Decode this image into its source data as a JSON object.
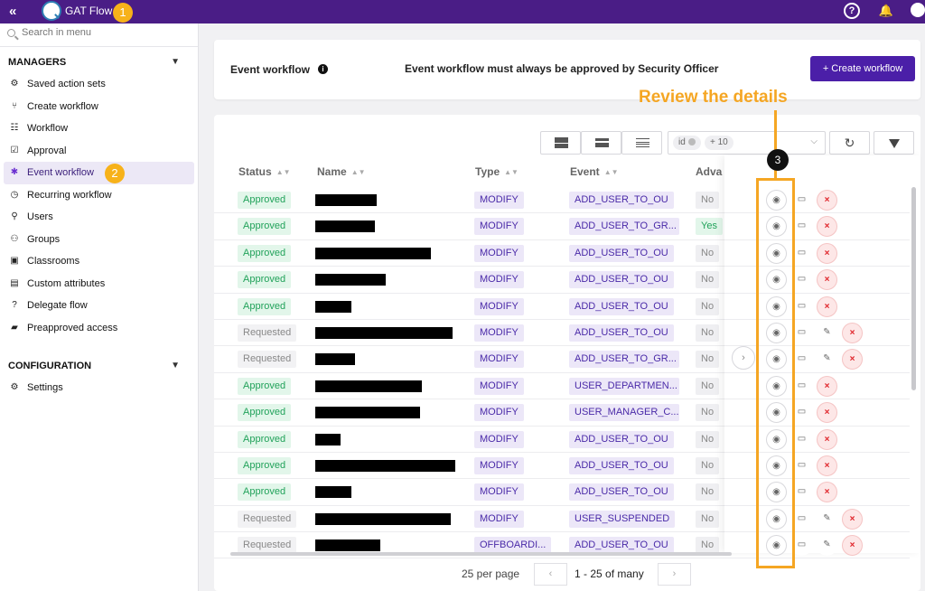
{
  "app": {
    "title": "GAT Flow"
  },
  "annotations": {
    "step1": "1",
    "step2": "2",
    "step3": "3",
    "callout": "Review the details"
  },
  "sidebar": {
    "search_placeholder": "Search in menu",
    "managers_label": "MANAGERS",
    "items": [
      {
        "label": "Saved action sets",
        "icon": "gears-icon"
      },
      {
        "label": "Create workflow",
        "icon": "fork-icon"
      },
      {
        "label": "Workflow",
        "icon": "hierarchy-icon"
      },
      {
        "label": "Approval",
        "icon": "checklist-icon"
      },
      {
        "label": "Event workflow",
        "icon": "siren-icon",
        "active": true
      },
      {
        "label": "Recurring workflow",
        "icon": "clock-icon"
      },
      {
        "label": "Users",
        "icon": "user-search-icon"
      },
      {
        "label": "Groups",
        "icon": "group-icon"
      },
      {
        "label": "Classrooms",
        "icon": "classroom-icon"
      },
      {
        "label": "Custom attributes",
        "icon": "id-card-icon"
      },
      {
        "label": "Delegate flow",
        "icon": "user-question-icon"
      },
      {
        "label": "Preapproved access",
        "icon": "ticket-icon"
      }
    ],
    "configuration_label": "CONFIGURATION",
    "settings_label": "Settings"
  },
  "header": {
    "title": "Event workflow",
    "message": "Event workflow must always be approved by Security Officer",
    "create_button": "+ Create workflow"
  },
  "toolbar": {
    "filter_chip_1": "id",
    "filter_chip_2": "+ 10"
  },
  "table": {
    "columns": {
      "status": "Status",
      "name": "Name",
      "type": "Type",
      "event": "Event",
      "advanced": "Adva"
    },
    "rows": [
      {
        "status": "Approved",
        "type": "MODIFY",
        "event": "ADD_USER_TO_OU",
        "adv": "No"
      },
      {
        "status": "Approved",
        "type": "MODIFY",
        "event": "ADD_USER_TO_GR...",
        "adv": "Yes"
      },
      {
        "status": "Approved",
        "type": "MODIFY",
        "event": "ADD_USER_TO_OU",
        "adv": "No"
      },
      {
        "status": "Approved",
        "type": "MODIFY",
        "event": "ADD_USER_TO_OU",
        "adv": "No"
      },
      {
        "status": "Approved",
        "type": "MODIFY",
        "event": "ADD_USER_TO_OU",
        "adv": "No"
      },
      {
        "status": "Requested",
        "type": "MODIFY",
        "event": "ADD_USER_TO_OU",
        "adv": "No"
      },
      {
        "status": "Requested",
        "type": "MODIFY",
        "event": "ADD_USER_TO_GR...",
        "adv": "No"
      },
      {
        "status": "Approved",
        "type": "MODIFY",
        "event": "USER_DEPARTMEN...",
        "adv": "No"
      },
      {
        "status": "Approved",
        "type": "MODIFY",
        "event": "USER_MANAGER_C...",
        "adv": "No"
      },
      {
        "status": "Approved",
        "type": "MODIFY",
        "event": "ADD_USER_TO_OU",
        "adv": "No"
      },
      {
        "status": "Approved",
        "type": "MODIFY",
        "event": "ADD_USER_TO_OU",
        "adv": "No"
      },
      {
        "status": "Approved",
        "type": "MODIFY",
        "event": "ADD_USER_TO_OU",
        "adv": "No"
      },
      {
        "status": "Requested",
        "type": "MODIFY",
        "event": "USER_SUSPENDED",
        "adv": "No"
      },
      {
        "status": "Requested",
        "type": "OFFBOARDI...",
        "event": "ADD_USER_TO_OU",
        "adv": "No"
      }
    ]
  },
  "pagination": {
    "per_page": "25 per page",
    "range": "1 - 25 of many"
  }
}
